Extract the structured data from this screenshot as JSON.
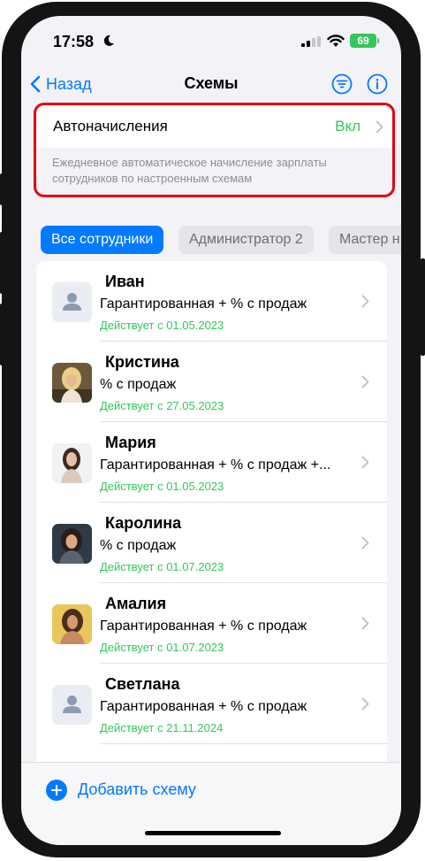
{
  "status_bar": {
    "time": "17:58",
    "battery": "69"
  },
  "nav": {
    "back_label": "Назад",
    "title": "Схемы"
  },
  "auto_accrual": {
    "label": "Автоначисления",
    "value": "Вкл",
    "description": "Ежедневное автоматическое начисление зарплаты сотрудников по настроенным схемам"
  },
  "filters": [
    "Все сотрудники",
    "Администратор 2",
    "Мастер н"
  ],
  "employees": [
    {
      "name": "Иван",
      "scheme": "Гарантированная + % с продаж",
      "since": "Действует с 01.05.2023",
      "avatar": "placeholder-icon"
    },
    {
      "name": "Кристина",
      "scheme": "% с продаж",
      "since": "Действует с 27.05.2023",
      "avatar": "photo"
    },
    {
      "name": "Мария",
      "scheme": "Гарантированная + % с продаж +...",
      "since": "Действует с 01.05.2023",
      "avatar": "photo"
    },
    {
      "name": "Каролина",
      "scheme": "% с продаж",
      "since": "Действует с 01.07.2023",
      "avatar": "photo"
    },
    {
      "name": "Амалия",
      "scheme": "Гарантированная + % с продаж",
      "since": "Действует с 01.07.2023",
      "avatar": "photo"
    },
    {
      "name": "Светлана",
      "scheme": "Гарантированная + % с продаж",
      "since": "Действует с 21.11.2024",
      "avatar": "placeholder-icon"
    }
  ],
  "bottom": {
    "add_label": "Добавить схему"
  },
  "colors": {
    "accent": "#007aff",
    "success": "#34c759",
    "highlight": "#e3000f"
  }
}
